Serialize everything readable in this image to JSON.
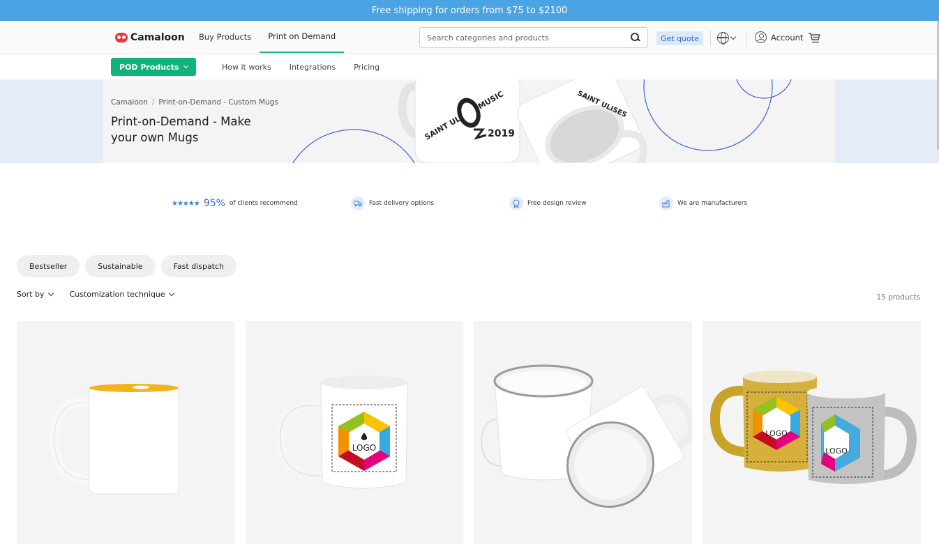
{
  "banner": {
    "text": "Free shipping for orders from $75 to $2100"
  },
  "header": {
    "logo": "Camaloon",
    "nav": [
      {
        "label": "Buy Products"
      },
      {
        "label": "Print on Demand",
        "active": true
      }
    ],
    "search_placeholder": "Search categories and products",
    "quote_label": "Get quote",
    "account_label": "Account"
  },
  "subnav": {
    "pod_button": "POD Products",
    "links": [
      "How it works",
      "Integrations",
      "Pricing"
    ]
  },
  "hero": {
    "breadcrumb": [
      "Camaloon",
      "Print-on-Demand - Custom Mugs"
    ],
    "title": "Print-on-Demand - Make your own Mugs",
    "mug_text_1": "SAINT ULISES MUSIC",
    "mug_year": "2019"
  },
  "features": {
    "rating_stars": "★★★★★",
    "rating_pct": "95%",
    "rating_text": "of clients recommend",
    "delivery": "Fast delivery options",
    "design": "Free design review",
    "manufacturers": "We are manufacturers"
  },
  "filters": {
    "chips": [
      "Bestseller",
      "Sustainable",
      "Fast dispatch"
    ],
    "sort_label": "Sort by",
    "technique_label": "Customization technique",
    "count": "15 products"
  },
  "products": [
    {
      "name": "white-mug-yellow-inside"
    },
    {
      "name": "white-mug-logo",
      "logo_text": "LOGO"
    },
    {
      "name": "enamel-mugs"
    },
    {
      "name": "glitter-mugs",
      "logo_text": "LOGO"
    }
  ],
  "colors": {
    "accent": "#10b37a",
    "banner": "#4aa3e2",
    "link": "#2f6bd6"
  }
}
